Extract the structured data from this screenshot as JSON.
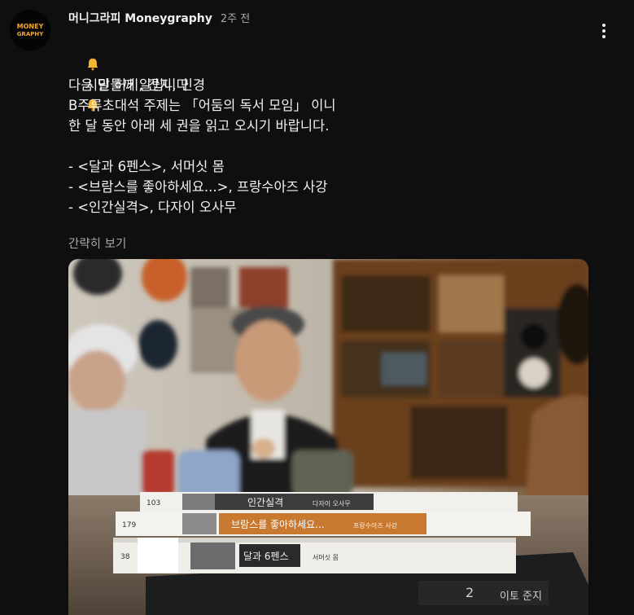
{
  "channel": {
    "name": "머니그라피 Moneygraphy",
    "time": "2주 전"
  },
  "post": {
    "lines": [
      "시민들께 알립니다",
      "",
      "다음 달 허키, 간지, 민경",
      "B주류초대석 주제는 「어둠의 독서 모임」 이니",
      "한 달 동안 아래 세 권을 읽고 오시기 바랍니다.",
      "",
      "- <달과 6펜스>, 서머싯 몸",
      "- <브람스를 좋아하세요...>, 프랑수아즈 사강",
      "- <인간실격>, 다자이 오사무"
    ],
    "show_less": "간략히 보기"
  },
  "photo": {
    "books": [
      {
        "spine_number": "103",
        "spine_title": "인간실격",
        "spine_author": "다자이 오사무"
      },
      {
        "spine_number": "179",
        "spine_title": "브람스를 좋아하세요...",
        "spine_author": "프랑수아즈 사강"
      },
      {
        "spine_number": "38",
        "spine_title": "달과 6펜스",
        "spine_author": "서머싯 몸"
      },
      {
        "spine_number": "2",
        "spine_title": "이토 준지",
        "spine_author": ""
      }
    ]
  },
  "colors": {
    "background": "#0f0f0f",
    "text_primary": "#f1f1f1",
    "text_secondary": "#aaaaaa",
    "logo_orange": "#f5a623"
  },
  "icons": {
    "avatar": "moneygraphy-logo",
    "bell": "bell-emoji",
    "menu": "more-vertical-icon"
  }
}
